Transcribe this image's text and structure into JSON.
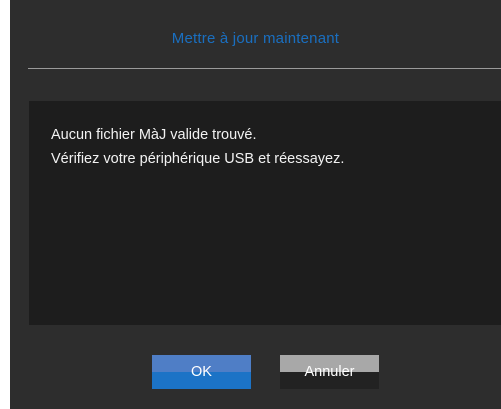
{
  "dialog": {
    "title": "Mettre à jour maintenant",
    "message": {
      "line1": "Aucun fichier MàJ valide trouvé.",
      "line2": "Vérifiez votre périphérique USB et réessayez."
    },
    "buttons": {
      "ok_label": "OK",
      "cancel_label": "Annuler"
    }
  },
  "colors": {
    "title_text": "#1a6fc0",
    "background": "#2d2d2d",
    "panel": "#1d1d1d",
    "ok_button": "#1c73c6",
    "cancel_button": "#222222"
  }
}
